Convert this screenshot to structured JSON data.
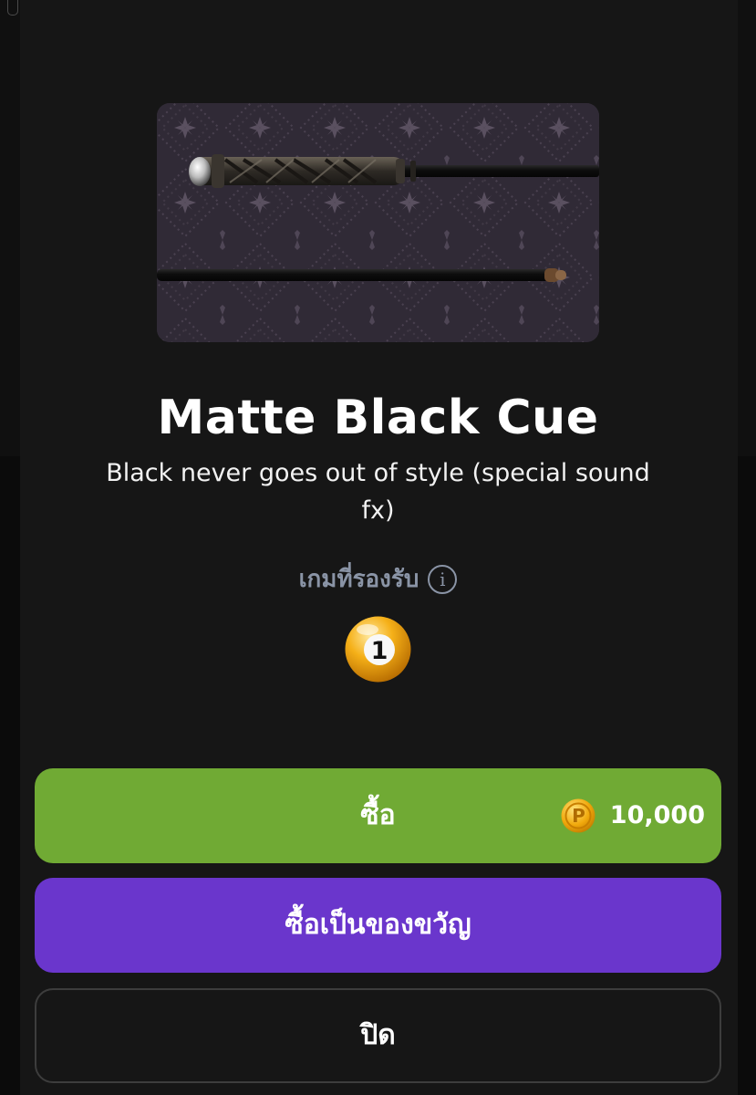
{
  "item": {
    "name": "Matte Black Cue",
    "description": "Black never goes out of style (special sound fx)"
  },
  "compatible_games": {
    "label": "เกมที่รองรับ",
    "info_icon": "info-circle-icon",
    "games": [
      {
        "icon": "billiard-ball-1-icon",
        "number": "1"
      }
    ]
  },
  "actions": {
    "buy_label": "ซื้อ",
    "price": "10,000",
    "currency_icon": "coin-p-icon",
    "gift_label": "ซื้อเป็นของขวัญ",
    "close_label": "ปิด"
  },
  "colors": {
    "buy": "#70aa34",
    "gift": "#6a36cc",
    "background": "#161616",
    "muted_text": "#8a94a6"
  }
}
